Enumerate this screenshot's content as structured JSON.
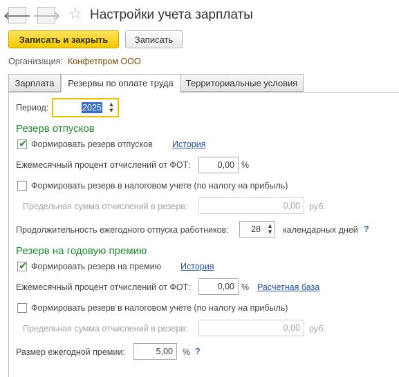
{
  "window": {
    "title": "Настройки учета зарплаты"
  },
  "nav": {
    "back_glyph": "🡐",
    "forward_glyph": "🡒",
    "star_glyph": "☆"
  },
  "toolbar": {
    "save_close_label": "Записать и закрыть",
    "save_label": "Записать"
  },
  "organization": {
    "label": "Организация:",
    "value": "Конфетпром ООО"
  },
  "tabs": [
    {
      "label": "Зарплата",
      "active": false
    },
    {
      "label": "Резервы по оплате труда",
      "active": true
    },
    {
      "label": "Территориальные условия",
      "active": false
    }
  ],
  "period": {
    "label": "Период:",
    "value": "2025"
  },
  "vacation": {
    "title": "Резерв отпусков",
    "form_reserve": {
      "label": "Формировать резерв отпусков",
      "checked": true,
      "link": "История"
    },
    "monthly_percent": {
      "label": "Ежемесячный процент отчислений от ФОТ:",
      "value": "0,00",
      "unit": "%"
    },
    "tax_reserve": {
      "label": "Формировать резерв в налоговом учете (по налогу на прибыль)",
      "checked": false
    },
    "limit": {
      "label": "Предельная сумма отчислений в резерв:",
      "value": "0,00",
      "unit": "руб."
    },
    "duration": {
      "label": "Продолжительность ежегодного отпуска работников:",
      "value": "28",
      "unit": "календарных дней",
      "help": "?"
    }
  },
  "bonus": {
    "title": "Резерв на годовую премию",
    "form_reserve": {
      "label": "Формировать резерв на премию",
      "checked": true,
      "link": "История"
    },
    "monthly_percent": {
      "label": "Ежемесячный процент отчислений от ФОТ:",
      "value": "0,00",
      "unit": "%",
      "link": "Расчетная база"
    },
    "tax_reserve": {
      "label": "Формировать резерв в налоговом учете (по налогу на прибыль)",
      "checked": false
    },
    "limit": {
      "label": "Предельная сумма отчислений в резерв:",
      "value": "0,00",
      "unit": "руб."
    },
    "size": {
      "label": "Размер ежегодной премии:",
      "value": "5,00",
      "unit": "%",
      "help": "?"
    }
  },
  "colors": {
    "section_title": "#1e8a2d",
    "link": "#1f4fa8",
    "primary_button": "#f2c700",
    "focus_border": "#f0c000"
  }
}
